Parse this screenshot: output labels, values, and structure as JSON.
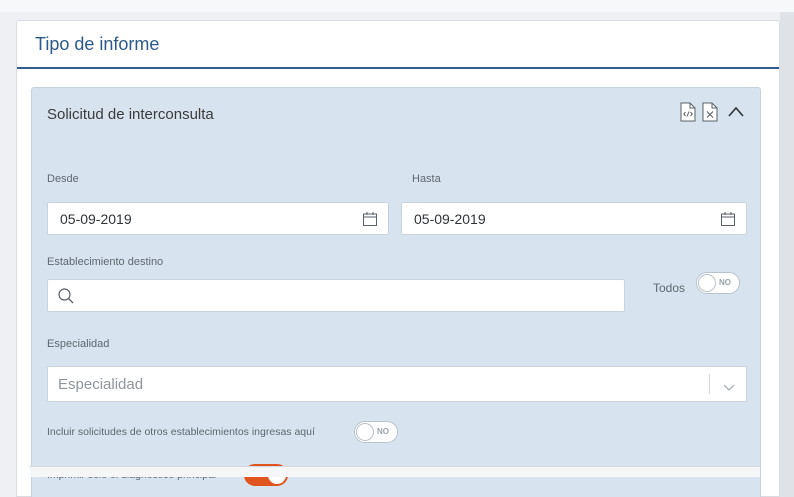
{
  "card": {
    "title": "Tipo de informe"
  },
  "panel": {
    "title": "Solicitud de interconsulta",
    "icons": [
      "xml-file-icon",
      "excel-file-icon",
      "chevron-up-icon"
    ]
  },
  "form": {
    "desde_label": "Desde",
    "desde_value": "05-09-2019",
    "hasta_label": "Hasta",
    "hasta_value": "05-09-2019",
    "establecimiento_label": "Establecimiento destino",
    "establecimiento_value": "",
    "todos_label": "Todos",
    "todos_toggle": "NO",
    "especialidad_label": "Especialidad",
    "especialidad_placeholder": "Especialidad",
    "incluir_label": "Incluir solicitudes de otros establecimientos ingresas aquí",
    "incluir_toggle": "NO",
    "imprimir_label": "Imprimir solo el diagnóstico principal",
    "imprimir_toggle": "SI"
  },
  "colors": {
    "accent": "#2c5a8c",
    "panel_bg": "#d7e4ef",
    "toggle_on": "#e2541f"
  }
}
